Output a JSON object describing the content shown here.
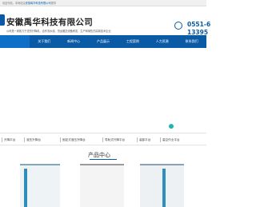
{
  "topbar": {
    "left_text": "欢迎光临，本网站由",
    "highlight": "安徽禹华科技有限公司",
    "right_text": "提供"
  },
  "header": {
    "company_name": "安徽禹华科技有限公司",
    "slogan": "公司是一家致力于送货升降机、合作流水线、货运搬送设备研发、生产和销售的高新技术企业",
    "phone1": "0551-6",
    "phone2": "13395",
    "phone_icon": "phone-icon"
  },
  "nav": {
    "items": [
      {
        "label": "关于我们"
      },
      {
        "label": "新闻中心"
      },
      {
        "label": "产品展示"
      },
      {
        "label": "工程案例"
      },
      {
        "label": "人力资源"
      },
      {
        "label": "联系我们"
      }
    ],
    "active_index": 0
  },
  "categories": {
    "items": [
      {
        "label": "升降平台"
      },
      {
        "label": "液压升降台"
      },
      {
        "label": "固定式液压升降台"
      },
      {
        "label": "导轨式升降平台"
      },
      {
        "label": "装卸平台"
      },
      {
        "label": "高空作业平台"
      }
    ]
  },
  "products": {
    "title": "产品中心"
  },
  "colors": {
    "primary": "#0a5aa6",
    "accent": "#1db6b0"
  }
}
